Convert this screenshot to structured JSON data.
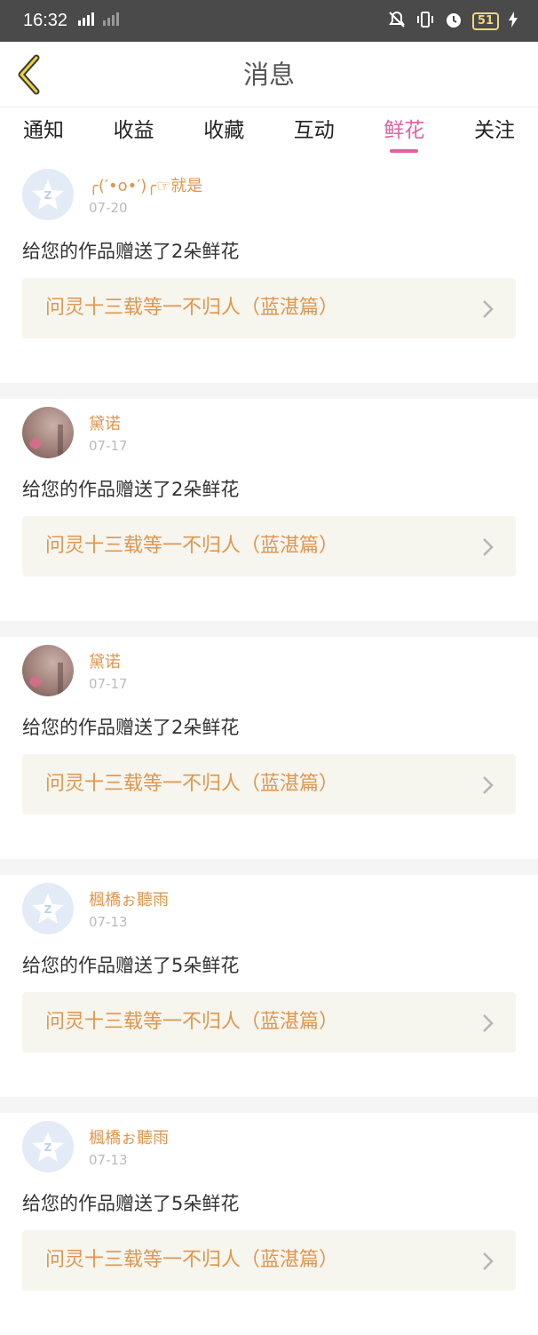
{
  "statusbar": {
    "time": "16:32",
    "battery": "51",
    "net": "4G"
  },
  "header": {
    "title": "消息"
  },
  "tabs": [
    {
      "label": "通知"
    },
    {
      "label": "收益"
    },
    {
      "label": "收藏"
    },
    {
      "label": "互动"
    },
    {
      "label": "鲜花",
      "active": true
    },
    {
      "label": "关注"
    }
  ],
  "items": [
    {
      "username": "╭(′•ο•′)╭☞就是",
      "date": "07-20",
      "message": "给您的作品赠送了2朵鲜花",
      "work": "问灵十三载等一不归人（蓝湛篇）",
      "avatar": "default"
    },
    {
      "username": "黛诺",
      "date": "07-17",
      "message": "给您的作品赠送了2朵鲜花",
      "work": "问灵十三载等一不归人（蓝湛篇）",
      "avatar": "photo"
    },
    {
      "username": "黛诺",
      "date": "07-17",
      "message": "给您的作品赠送了2朵鲜花",
      "work": "问灵十三载等一不归人（蓝湛篇）",
      "avatar": "photo"
    },
    {
      "username": "楓橋ぉ聽雨",
      "date": "07-13",
      "message": "给您的作品赠送了5朵鲜花",
      "work": "问灵十三载等一不归人（蓝湛篇）",
      "avatar": "default"
    },
    {
      "username": "楓橋ぉ聽雨",
      "date": "07-13",
      "message": "给您的作品赠送了5朵鲜花",
      "work": "问灵十三载等一不归人（蓝湛篇）",
      "avatar": "default"
    }
  ],
  "colors": {
    "accent": "#e35fa1",
    "username": "#e0964e",
    "card_bg": "#f6f5ee"
  }
}
